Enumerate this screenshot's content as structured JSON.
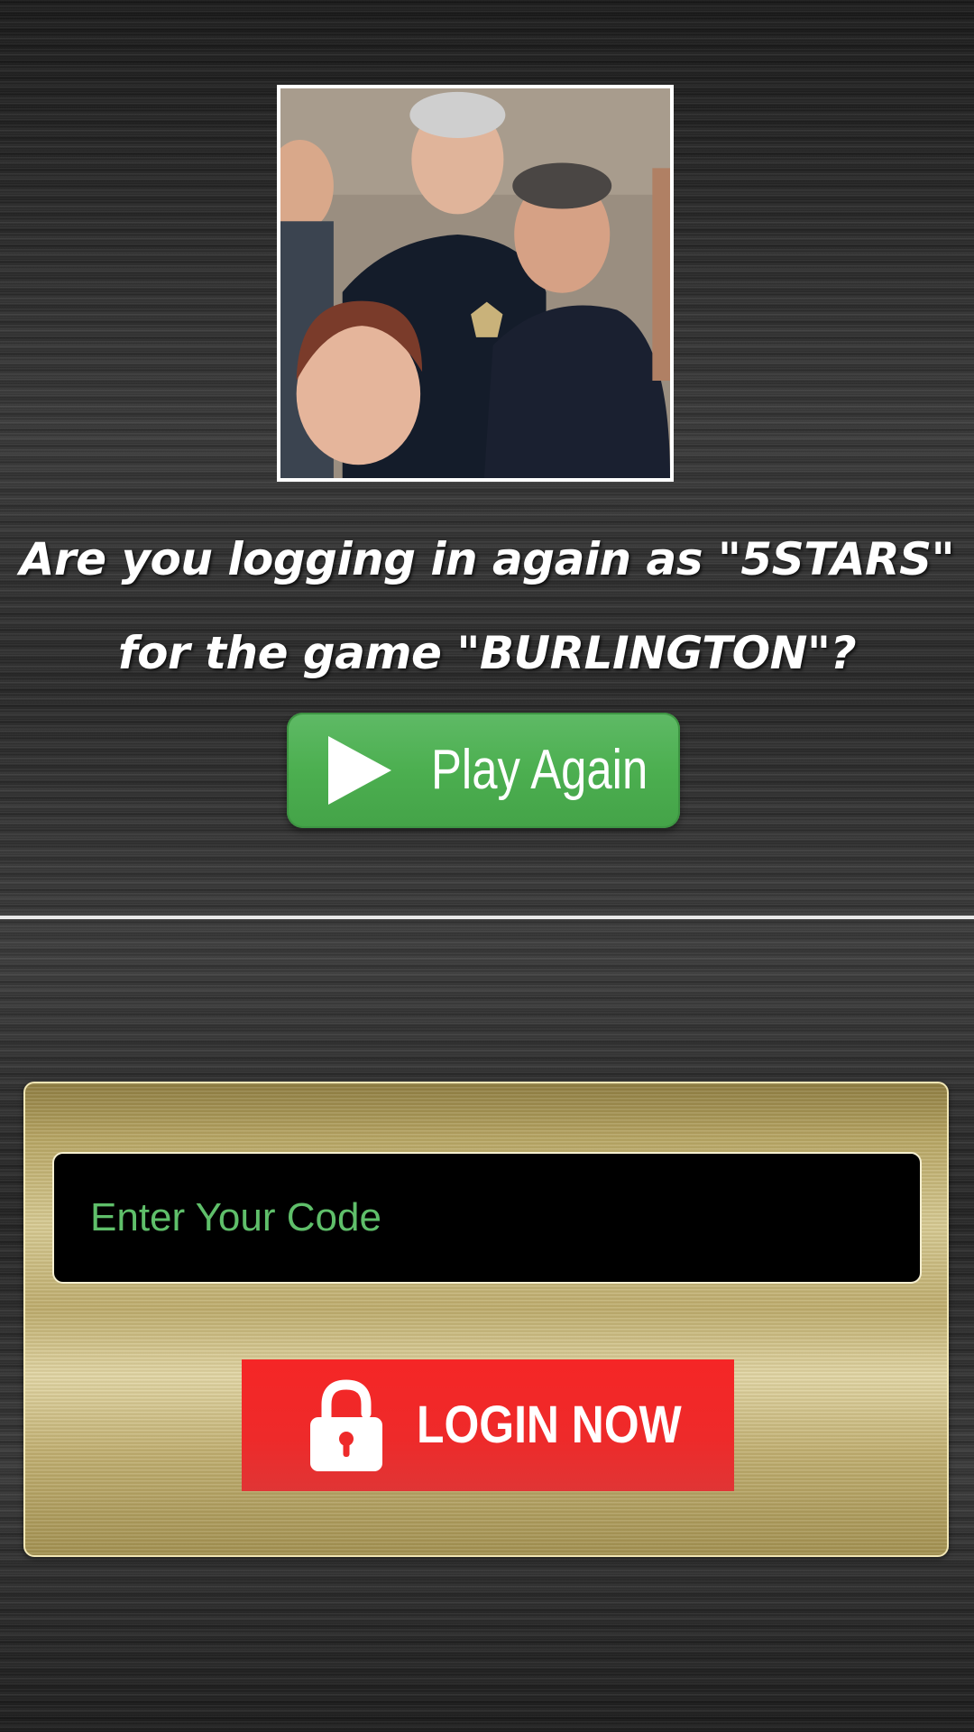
{
  "photo": {
    "alt": "group photo"
  },
  "prompt": {
    "line1": "Are you logging in again as \"5STARS\"",
    "line2": "for the game \"BURLINGTON\"?"
  },
  "play_button": {
    "label": "Play Again",
    "icon": "play-icon",
    "color": "#4caf50"
  },
  "login": {
    "code_input": {
      "value": "",
      "placeholder": "Enter Your Code"
    },
    "button": {
      "label": "LOGIN NOW",
      "icon": "lock-icon",
      "color": "#ee2a2a"
    }
  },
  "colors": {
    "background": "#2a2a2a",
    "panel_gold": "#c9b87a",
    "placeholder_green": "#5fbf6a"
  }
}
